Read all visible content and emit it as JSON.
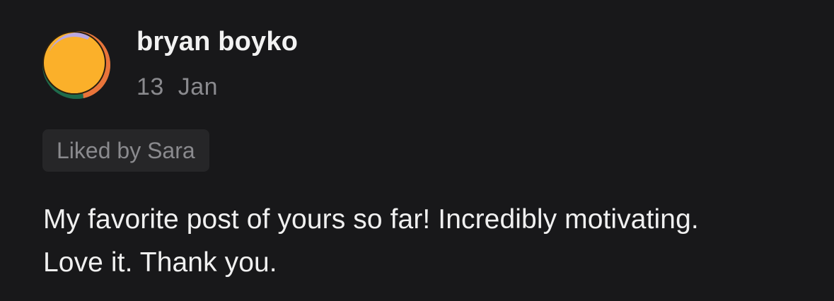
{
  "comment": {
    "author": "bryan boyko",
    "date": "13  Jan",
    "liked_by": "Liked by Sara",
    "text_lines": [
      "My favorite post of yours so far! Incredibly motivating.",
      "Love it. Thank you."
    ]
  },
  "colors": {
    "background": "#18181a",
    "author_text": "#f2f2f2",
    "meta_text": "#8a8a8e",
    "pill_background": "#262628",
    "avatar_yellow": "#fbb02a",
    "avatar_green": "#1e6b4c",
    "avatar_orange": "#e9743a",
    "avatar_lavender": "#b9a7e0"
  },
  "icons": {
    "avatar": "avatar-image"
  }
}
